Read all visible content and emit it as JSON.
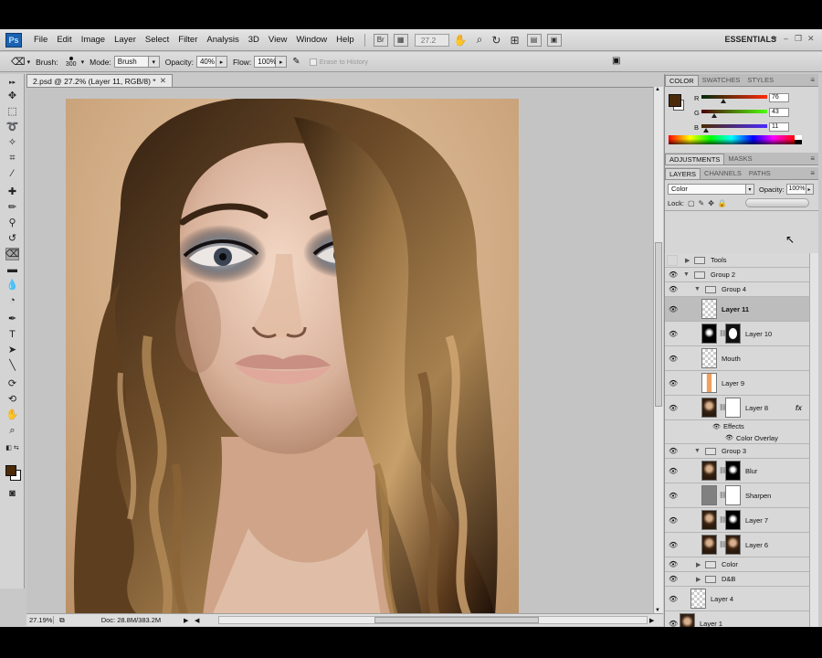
{
  "app": {
    "logo": "Ps",
    "workspace": "ESSENTIALS"
  },
  "menu": [
    "File",
    "Edit",
    "Image",
    "Layer",
    "Select",
    "Filter",
    "Analysis",
    "3D",
    "View",
    "Window",
    "Help"
  ],
  "zoom_field": "27.2",
  "options": {
    "brush_label": "Brush:",
    "brush_size": "300",
    "mode_label": "Mode:",
    "mode_value": "Brush",
    "opacity_label": "Opacity:",
    "opacity_value": "40%",
    "flow_label": "Flow:",
    "flow_value": "100%",
    "erase_history": "Erase to History"
  },
  "document": {
    "tab_title": "2.psd @ 27.2% (Layer 11, RGB/8) *",
    "zoom": "27.19%",
    "doc_size": "Doc: 28.8M/383.2M"
  },
  "color_panel": {
    "tabs": [
      "COLOR",
      "SWATCHES",
      "STYLES"
    ],
    "r_label": "R",
    "g_label": "G",
    "b_label": "B",
    "r": "76",
    "g": "43",
    "b": "11",
    "foreground": "#4c2b0b"
  },
  "adjustments_tabs": [
    "ADJUSTMENTS",
    "MASKS"
  ],
  "layers_panel": {
    "tabs": [
      "LAYERS",
      "CHANNELS",
      "PATHS"
    ],
    "blend_mode": "Color",
    "opacity_label": "Opacity:",
    "opacity": "100%",
    "lock_label": "Lock:",
    "layers": [
      {
        "name": "Tools",
        "kind": "group"
      },
      {
        "name": "Group 2",
        "kind": "group"
      },
      {
        "name": "Group 4",
        "kind": "group"
      },
      {
        "name": "Layer 11",
        "kind": "layer"
      },
      {
        "name": "Layer 10",
        "kind": "layer"
      },
      {
        "name": "Mouth",
        "kind": "layer"
      },
      {
        "name": "Layer 9",
        "kind": "layer"
      },
      {
        "name": "Layer 8",
        "kind": "layer"
      },
      {
        "name": "Effects",
        "kind": "effect"
      },
      {
        "name": "Color Overlay",
        "kind": "effect"
      },
      {
        "name": "Group 3",
        "kind": "group"
      },
      {
        "name": "Blur",
        "kind": "layer"
      },
      {
        "name": "Sharpen",
        "kind": "layer"
      },
      {
        "name": "Layer 7",
        "kind": "layer"
      },
      {
        "name": "Layer 6",
        "kind": "layer"
      },
      {
        "name": "Color",
        "kind": "group"
      },
      {
        "name": "D&B",
        "kind": "group"
      },
      {
        "name": "Layer 4",
        "kind": "layer"
      },
      {
        "name": "Layer 1",
        "kind": "layer"
      }
    ],
    "fx_label": "fx"
  }
}
